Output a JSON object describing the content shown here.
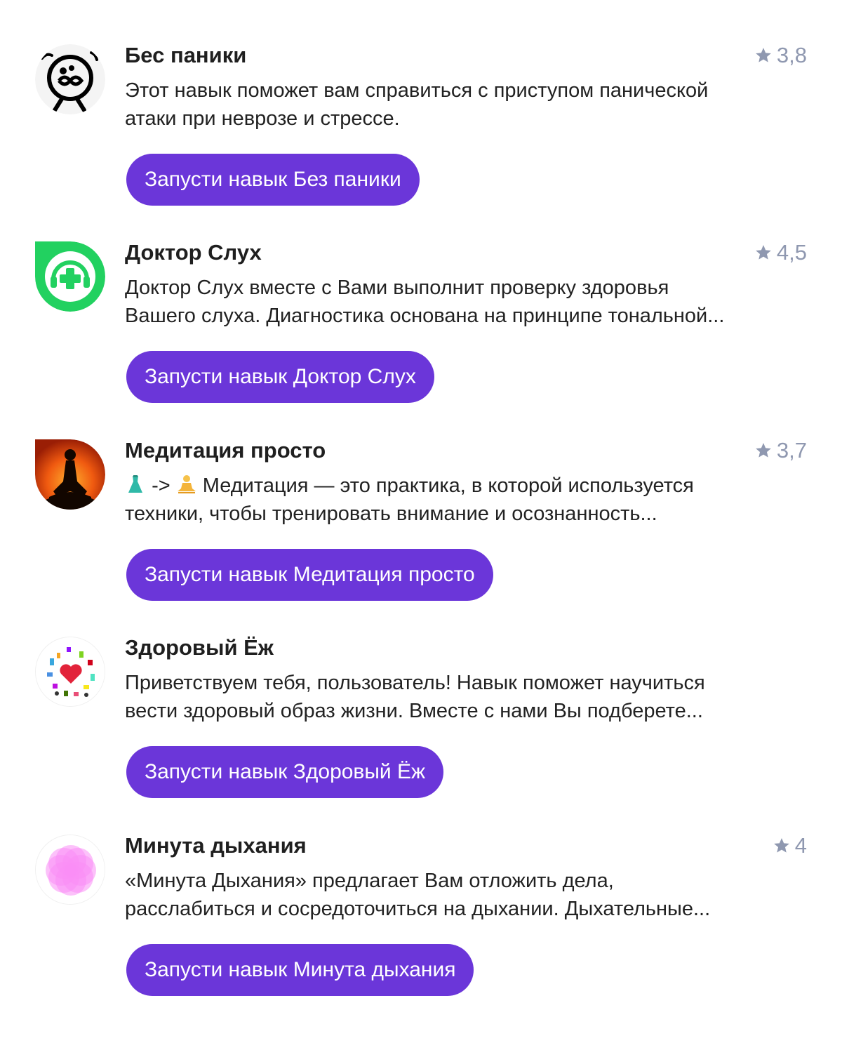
{
  "skills": [
    {
      "title": "Бес паники",
      "rating": "3,8",
      "description": [
        "Этот навык поможет вам справиться с приступом панической",
        "атаки при неврозе и стрессе."
      ],
      "button_label": "Запусти навык Без паники",
      "icon": "panic-face-icon"
    },
    {
      "title": "Доктор Слух",
      "rating": "4,5",
      "description": [
        "Доктор Слух вместе с Вами выполнит проверку здоровья",
        "Вашего слуха. Диагностика основана на принципе тональной..."
      ],
      "button_label": "Запусти навык Доктор Слух",
      "icon": "headphones-cross-icon",
      "icon_color": "#22d160"
    },
    {
      "title": "Медитация просто",
      "rating": "3,7",
      "description_prefix": "->",
      "description": [
        " Медитация — это практика, в которой используется",
        "техники, чтобы тренировать внимание и осознанность..."
      ],
      "button_label": "Запусти навык Медитация просто",
      "icon": "meditation-silhouette-icon",
      "emoji_before": "dress-emoji",
      "emoji_after": "lotus-position-emoji"
    },
    {
      "title": "Здоровый Ёж",
      "rating": "",
      "description": [
        "Приветствуем тебя, пользователь! Навык поможет научиться",
        "вести здоровый образ жизни. Вместе с нами Вы подберете..."
      ],
      "button_label": "Запусти навык Здоровый Ёж",
      "icon": "healthy-heart-collage-icon"
    },
    {
      "title": "Минута дыхания",
      "rating": "4",
      "description": [
        "«Минута Дыхания» предлагает Вам отложить дела,",
        "расслабиться и сосредоточиться на дыхании. Дыхательные..."
      ],
      "button_label": "Запусти навык Минута дыхания",
      "icon": "breathing-flower-icon",
      "icon_color": "#f98ef5"
    }
  ],
  "colors": {
    "button": "#6b36d9",
    "rating": "#8f98b0",
    "text": "#222222"
  }
}
